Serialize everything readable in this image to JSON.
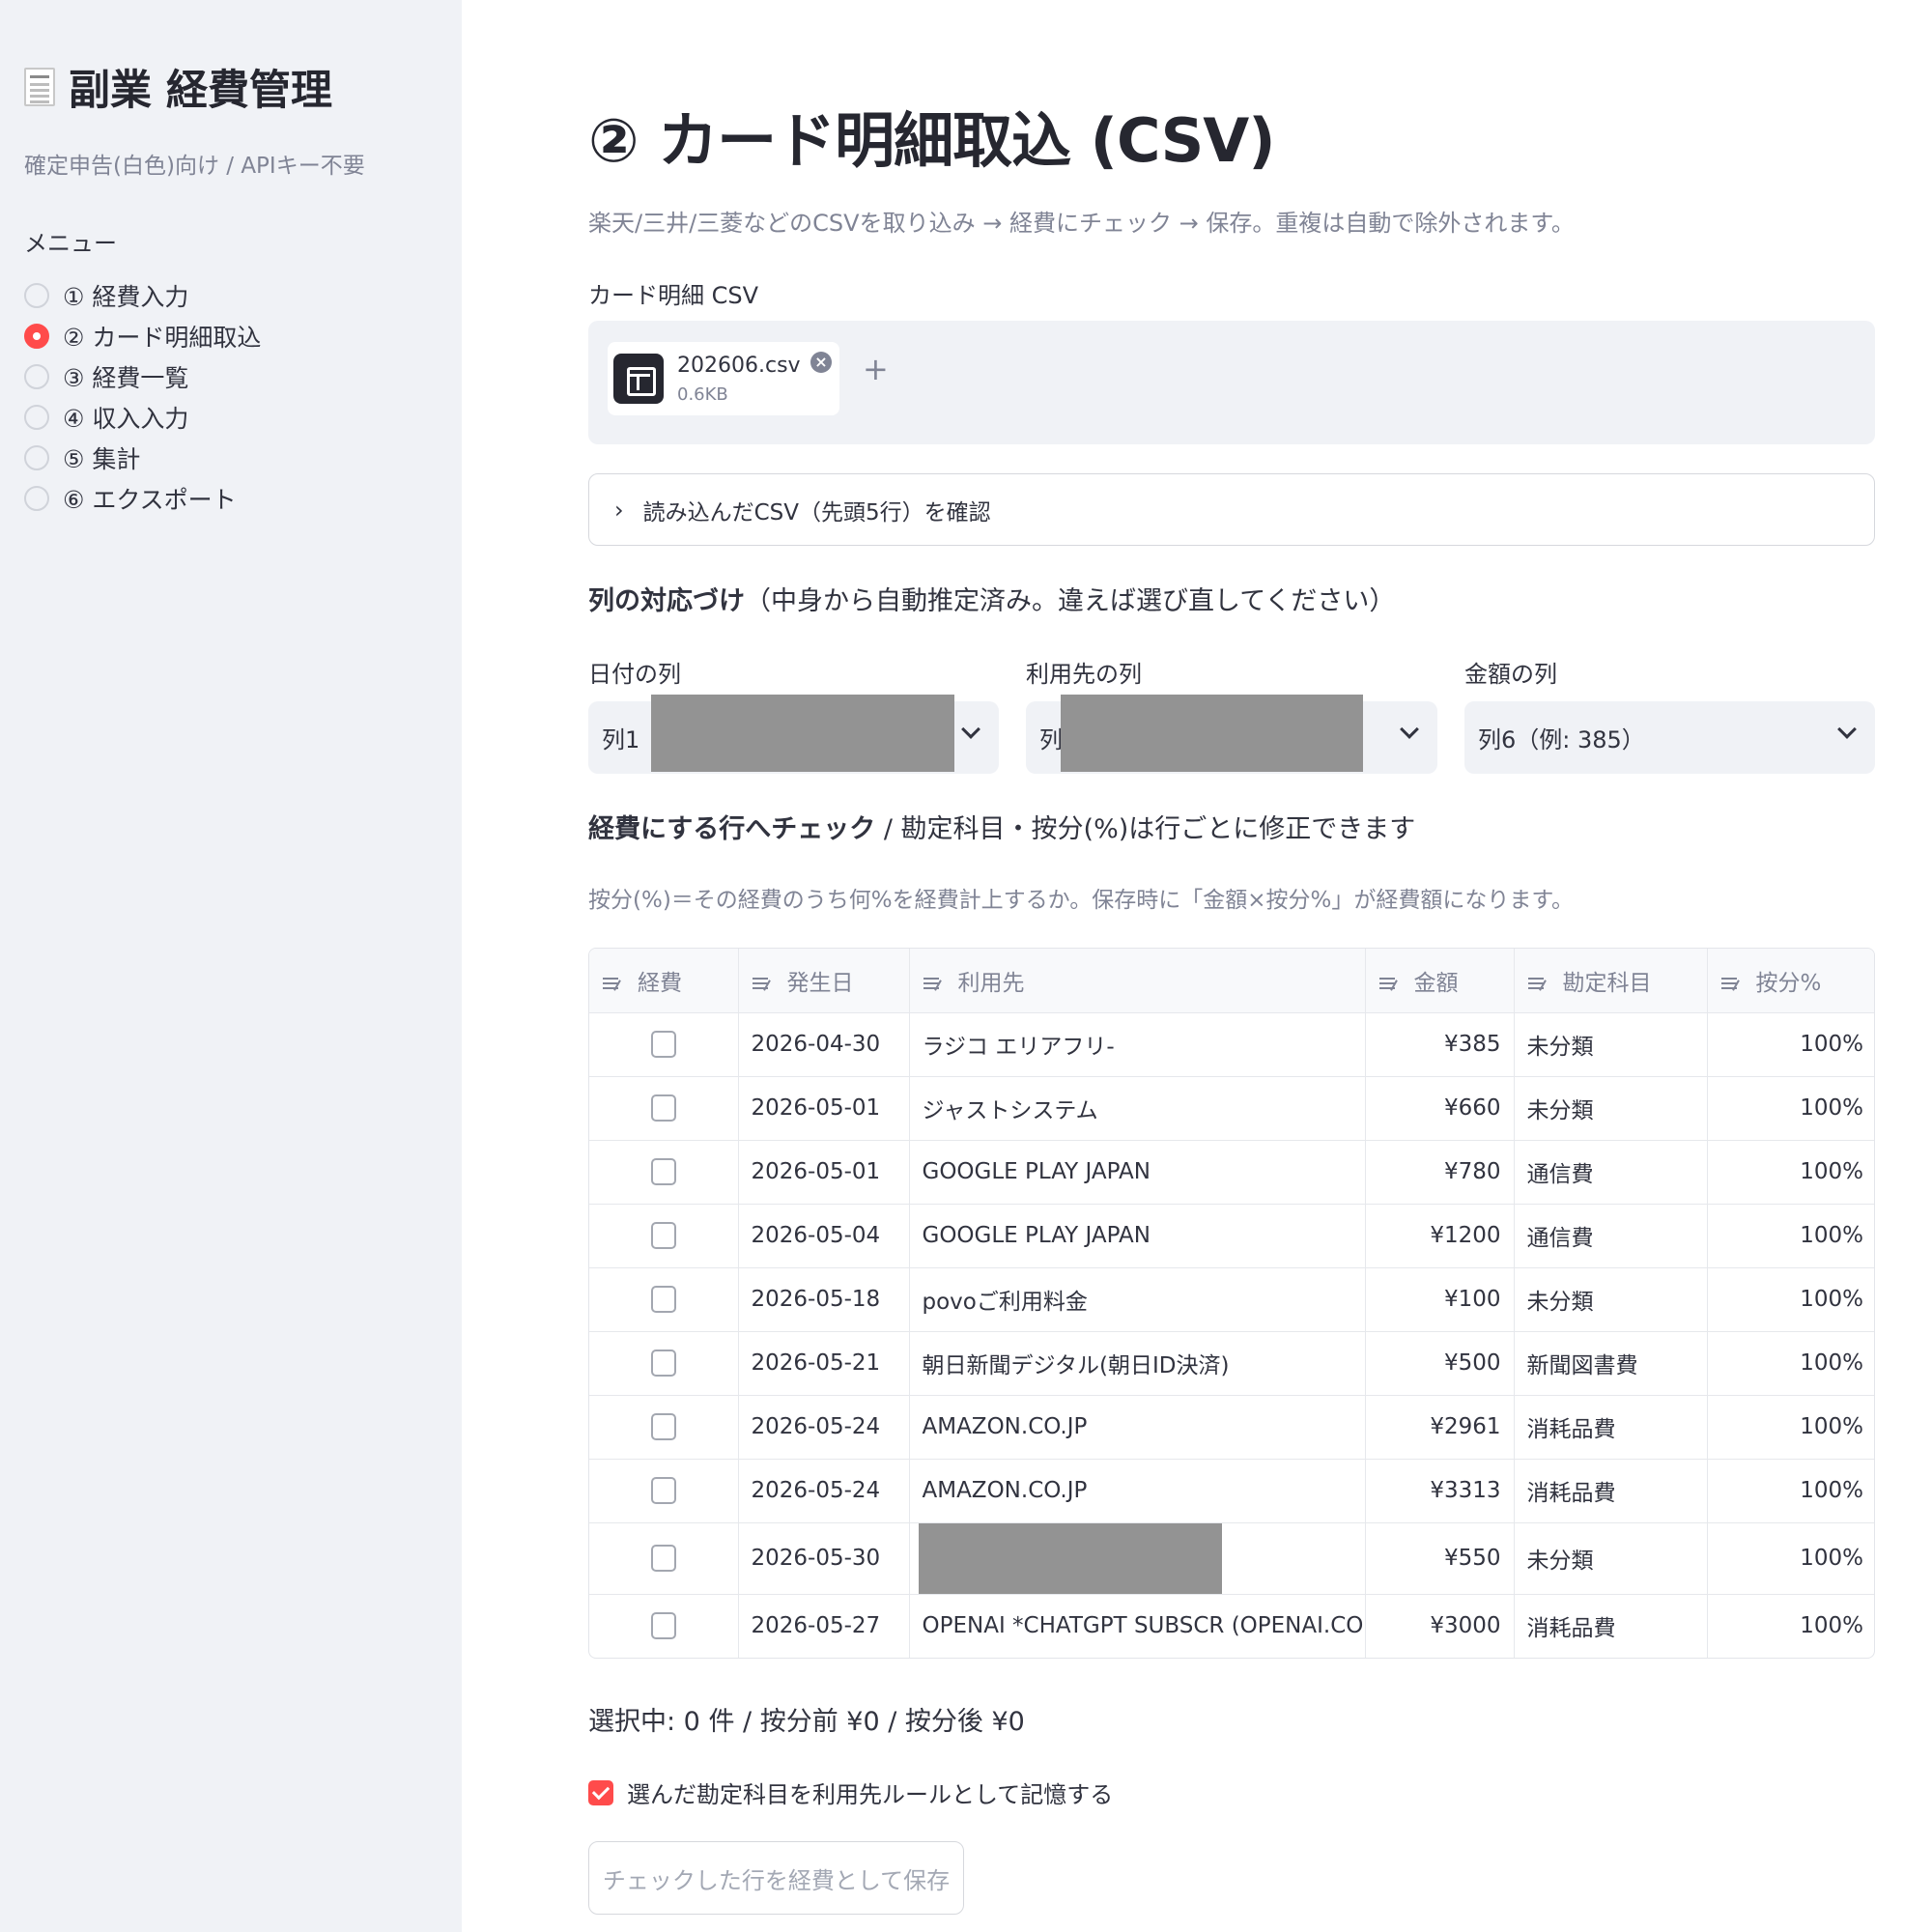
{
  "sidebar": {
    "title": "副業 経費管理",
    "subtitle": "確定申告(白色)向け / APIキー不要",
    "menu_label": "メニュー",
    "items": [
      {
        "label": "① 経費入力",
        "selected": false
      },
      {
        "label": "② カード明細取込",
        "selected": true
      },
      {
        "label": "③ 経費一覧",
        "selected": false
      },
      {
        "label": "④ 収入入力",
        "selected": false
      },
      {
        "label": "⑤ 集計",
        "selected": false
      },
      {
        "label": "⑥ エクスポート",
        "selected": false
      }
    ]
  },
  "main": {
    "title": "② カード明細取込 (CSV)",
    "description": "楽天/三井/三菱などのCSVを取り込み → 経費にチェック → 保存。重複は自動で除外されます。",
    "uploader_label": "カード明細 CSV",
    "file": {
      "name": "202606.csv",
      "size": "0.6KB",
      "remove_glyph": "×",
      "add_glyph": "+"
    },
    "expander_label": "読み込んだCSV（先頭5行）を確認",
    "mapping_heading_bold": "列の対応づけ",
    "mapping_heading_rest": "（中身から自動推定済み。違えば選び直してください）",
    "selects": [
      {
        "label": "日付の列",
        "value": "列1"
      },
      {
        "label": "利用先の列",
        "value": "列"
      },
      {
        "label": "金額の列",
        "value": "列6（例: 385）"
      }
    ],
    "check_heading_bold": "経費にする行へチェック",
    "check_heading_rest": " / 勘定科目・按分(%)は行ごとに修正できます",
    "hint": "按分(%)＝その経費のうち何%を経費計上するか。保存時に「金額×按分%」が経費額になります。",
    "table": {
      "columns": [
        "経費",
        "発生日",
        "利用先",
        "金額",
        "勘定科目",
        "按分%"
      ],
      "rows": [
        {
          "checked": false,
          "date": "2026-04-30",
          "payee": "ラジコ エリアフリ-",
          "amount": "¥385",
          "category": "未分類",
          "ratio": "100%"
        },
        {
          "checked": false,
          "date": "2026-05-01",
          "payee": "ジャストシステム",
          "amount": "¥660",
          "category": "未分類",
          "ratio": "100%"
        },
        {
          "checked": false,
          "date": "2026-05-01",
          "payee": "GOOGLE PLAY JAPAN",
          "amount": "¥780",
          "category": "通信費",
          "ratio": "100%"
        },
        {
          "checked": false,
          "date": "2026-05-04",
          "payee": "GOOGLE PLAY JAPAN",
          "amount": "¥1200",
          "category": "通信費",
          "ratio": "100%"
        },
        {
          "checked": false,
          "date": "2026-05-18",
          "payee": "povoご利用料金",
          "amount": "¥100",
          "category": "未分類",
          "ratio": "100%"
        },
        {
          "checked": false,
          "date": "2026-05-21",
          "payee": "朝日新聞デジタル(朝日ID決済)",
          "amount": "¥500",
          "category": "新聞図書費",
          "ratio": "100%"
        },
        {
          "checked": false,
          "date": "2026-05-24",
          "payee": "AMAZON.CO.JP",
          "amount": "¥2961",
          "category": "消耗品費",
          "ratio": "100%"
        },
        {
          "checked": false,
          "date": "2026-05-24",
          "payee": "AMAZON.CO.JP",
          "amount": "¥3313",
          "category": "消耗品費",
          "ratio": "100%"
        },
        {
          "checked": false,
          "date": "2026-05-30",
          "payee": "",
          "amount": "¥550",
          "category": "未分類",
          "ratio": "100%"
        },
        {
          "checked": false,
          "date": "2026-05-27",
          "payee": "OPENAI *CHATGPT SUBSCR (OPENAI.COM )",
          "amount": "¥3000",
          "category": "消耗品費",
          "ratio": "100%"
        }
      ]
    },
    "summary": "選択中: 0 件 / 按分前 ¥0 / 按分後 ¥0",
    "remember_label": "選んだ勘定科目を利用先ルールとして記憶する",
    "remember_checked": true,
    "save_button": "チェックした行を経費として保存"
  },
  "colors": {
    "accent": "#ff4b4b",
    "sidebar_bg": "#f0f2f6",
    "muted_text": "#808495"
  }
}
